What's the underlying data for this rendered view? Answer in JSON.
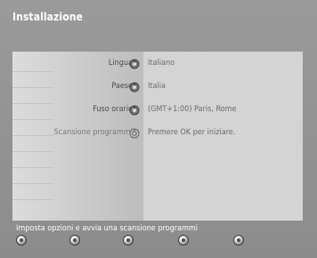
{
  "header": {
    "title": "Installazione"
  },
  "settings": [
    {
      "label": "Lingua",
      "value": "Italiano",
      "icon": "dial-icon"
    },
    {
      "label": "Paese",
      "value": "Italia",
      "icon": "dial-icon"
    },
    {
      "label": "Fuso orario",
      "value": "(GMT+1:00) Paris, Rome",
      "icon": "dial-icon"
    },
    {
      "label": "Scansione programmi",
      "value": "Premere OK per iniziare.",
      "icon": "scan-dial-icon"
    }
  ],
  "footer": {
    "help_text": "Imposta opzioni e avvia una scansione programmi"
  }
}
